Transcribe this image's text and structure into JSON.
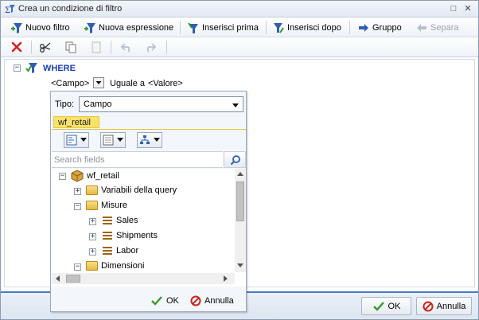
{
  "title": "Crea un condizione di filtro",
  "toolbar": {
    "nuovo_filtro": "Nuovo filtro",
    "nuova_espressione": "Nuova espressione",
    "inserisci_prima": "Inserisci prima",
    "inserisci_dopo": "Inserisci dopo",
    "gruppo": "Gruppo",
    "separa": "Separa"
  },
  "condition": {
    "root_label": "WHERE",
    "field": "<Campo>",
    "operator": "Uguale a",
    "value": "<Valore>"
  },
  "popup": {
    "tipo_label": "Tipo:",
    "tipo_value": "Campo",
    "source_tab": "wf_retail",
    "search_placeholder": "Search fields",
    "tree": {
      "root": "wf_retail",
      "variabili": "Variabili della query",
      "misure": "Misure",
      "sales": "Sales",
      "shipments": "Shipments",
      "labor": "Labor",
      "dimensioni": "Dimensioni"
    },
    "ok": "OK",
    "annulla": "Annulla"
  },
  "footer": {
    "ok": "OK",
    "annulla": "Annulla"
  },
  "colors": {
    "accent": "#4a78c2",
    "where_text": "#1a3fb5",
    "tab_highlight": "#f7e36b",
    "ok_green": "#3a9a2c",
    "cancel_red": "#c8261d"
  }
}
